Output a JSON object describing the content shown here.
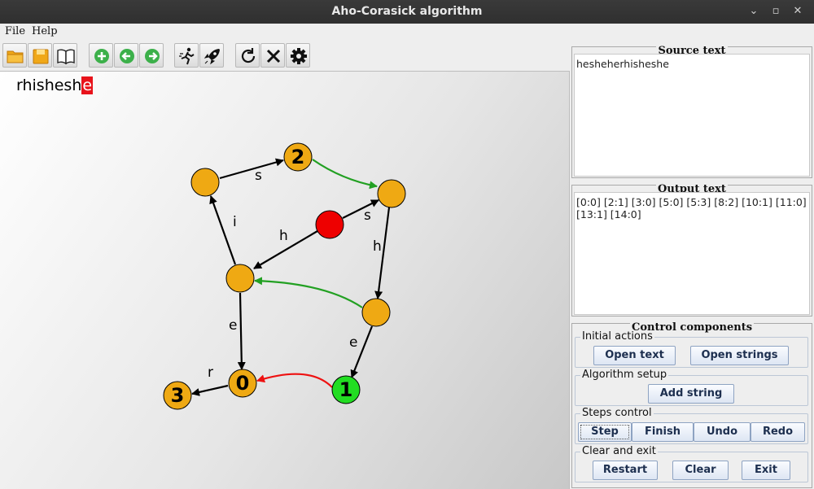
{
  "window": {
    "title": "Aho-Corasick algorithm"
  },
  "menu": {
    "file": "File",
    "help": "Help"
  },
  "toolbar": {
    "buttons": [
      "open-folder-icon",
      "save-icon",
      "book-icon",
      "plus-icon",
      "arrow-left-icon",
      "arrow-right-icon",
      "runner-icon",
      "rocket-icon",
      "refresh-icon",
      "close-x-icon",
      "gear-icon"
    ]
  },
  "canvas": {
    "progress_done": "rhishesh",
    "progress_current": "e",
    "nodes": [
      {
        "id": "n_s_top",
        "label": "",
        "color": "#efa913"
      },
      {
        "id": "n2",
        "label": "2",
        "color": "#efa913"
      },
      {
        "id": "n_right_top",
        "label": "",
        "color": "#efa913"
      },
      {
        "id": "root",
        "label": "",
        "color": "#ee0000"
      },
      {
        "id": "n_h",
        "label": "",
        "color": "#efa913"
      },
      {
        "id": "n_right_mid",
        "label": "",
        "color": "#efa913"
      },
      {
        "id": "n0",
        "label": "0",
        "color": "#efa913"
      },
      {
        "id": "n1",
        "label": "1",
        "color": "#22dd22"
      },
      {
        "id": "n3",
        "label": "3",
        "color": "#efa913"
      }
    ],
    "edges": [
      {
        "from": "n_s_top",
        "to": "n2",
        "label": "s"
      },
      {
        "from": "n_h",
        "to": "n_s_top",
        "label": "i"
      },
      {
        "from": "root",
        "to": "n_h",
        "label": "h"
      },
      {
        "from": "root",
        "to": "n_right_top",
        "label": "s"
      },
      {
        "from": "n_right_top",
        "to": "n_right_mid",
        "label": "h"
      },
      {
        "from": "n_h",
        "to": "n0",
        "label": "e"
      },
      {
        "from": "n_right_mid",
        "to": "n1",
        "label": "e"
      },
      {
        "from": "n0",
        "to": "n3",
        "label": "r"
      }
    ],
    "colors": {
      "fail_link": "#22a022",
      "active_link": "#ee1111",
      "edge": "#000000"
    }
  },
  "source": {
    "title": "Source text",
    "text": "hesheherhisheshe"
  },
  "output": {
    "title": "Output text",
    "line1": "[0:0] [2:1] [3:0] [5:0] [5:3] [8:2] [10:1] [11:0]",
    "line2": "[13:1] [14:0]"
  },
  "controls": {
    "title": "Control components",
    "initial": {
      "label": "Initial actions",
      "open_text": "Open text",
      "open_strings": "Open strings"
    },
    "setup": {
      "label": "Algorithm setup",
      "add_string": "Add string"
    },
    "steps": {
      "label": "Steps control",
      "step": "Step",
      "finish": "Finish",
      "undo": "Undo",
      "redo": "Redo"
    },
    "clear": {
      "label": "Clear and exit",
      "restart": "Restart",
      "clear": "Clear",
      "exit": "Exit"
    }
  }
}
